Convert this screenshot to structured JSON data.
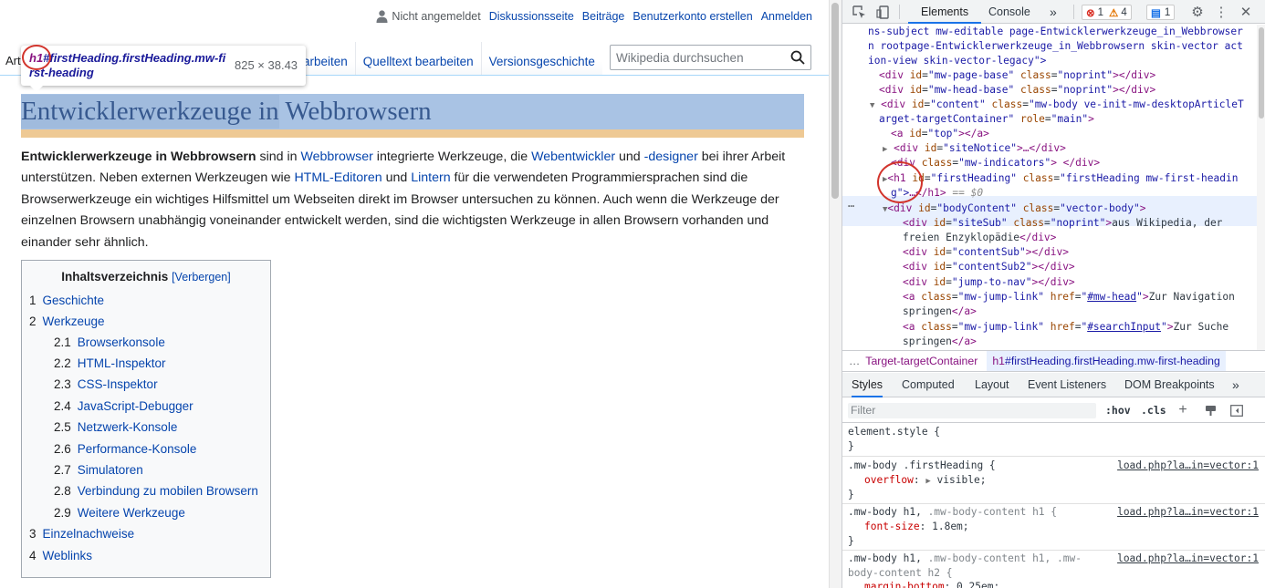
{
  "personal": {
    "anon": "Nicht angemeldet",
    "links": [
      "Diskussionsseite",
      "Beiträge",
      "Benutzerkonto erstellen",
      "Anmelden"
    ]
  },
  "tabs": {
    "left_partial": "Art",
    "right": [
      "Bearbeiten",
      "Quelltext bearbeiten",
      "Versionsgeschichte"
    ],
    "edit_partial": "arbeiten"
  },
  "search": {
    "placeholder": "Wikipedia durchsuchen"
  },
  "tooltip": {
    "tag": "h1",
    "selector": "#firstHeading.firstHeading.mw-first-heading",
    "size": "825 × 38.43"
  },
  "page": {
    "title": "Entwicklerwerkzeuge in Webbrowsern",
    "intro": {
      "bold": "Entwicklerwerkzeuge in Webbrowsern",
      "t1": " sind in ",
      "l1": "Webbrowser",
      "t2": " integrierte Werkzeuge, die ",
      "l2": "Webentwickler",
      "t3": " und ",
      "l3": "-designer",
      "t4": " bei ihrer Arbeit unterstützen. Neben externen Werkzeugen wie ",
      "l4": "HTML-Editoren",
      "t5": " und ",
      "l5": "Lintern",
      "t6": " für die verwendeten Programmiersprachen sind die Browserwerkzeuge ein wichtiges Hilfsmittel um Webseiten direkt im Browser untersuchen zu können. Auch wenn die Werkzeuge der einzelnen Browsern unabhängig voneinander entwickelt werden, sind die wichtigsten Werkzeuge in allen Browsern vorhanden und einander sehr ähnlich."
    }
  },
  "toc": {
    "title": "Inhaltsverzeichnis",
    "toggle": "[Verbergen]",
    "items": [
      {
        "num": "1",
        "label": "Geschichte"
      },
      {
        "num": "2",
        "label": "Werkzeuge"
      },
      {
        "num": "2.1",
        "label": "Browserkonsole"
      },
      {
        "num": "2.2",
        "label": "HTML-Inspektor"
      },
      {
        "num": "2.3",
        "label": "CSS-Inspektor"
      },
      {
        "num": "2.4",
        "label": "JavaScript-Debugger"
      },
      {
        "num": "2.5",
        "label": "Netzwerk-Konsole"
      },
      {
        "num": "2.6",
        "label": "Performance-Konsole"
      },
      {
        "num": "2.7",
        "label": "Simulatoren"
      },
      {
        "num": "2.8",
        "label": "Verbindung zu mobilen Browsern"
      },
      {
        "num": "2.9",
        "label": "Weitere Werkzeuge"
      },
      {
        "num": "3",
        "label": "Einzelnachweise"
      },
      {
        "num": "4",
        "label": "Weblinks"
      }
    ]
  },
  "devtools": {
    "tabs": [
      "Elements",
      "Console"
    ],
    "more": "»",
    "errors": "1",
    "warnings": "4",
    "messages": "1",
    "dom": {
      "l0": "ns-subject mw-editable page-Entwicklerwerkzeuge_in_Webbrowser",
      "l1": "n rootpage-Entwicklerwerkzeuge_in_Webbrowsern skin-vector act",
      "l2": "ion-view skin-vector-legacy\">",
      "page_base_id": "mw-page-base",
      "head_base_id": "mw-head-base",
      "noprint": "noprint",
      "content_id": "content",
      "content_class": "mw-body ve-init-mw-desktopArticleT",
      "content_class_cont": "arget-targetContainer",
      "content_role": "main",
      "top_id": "top",
      "sitenotice_id": "siteNotice",
      "indicators_class": "mw-indicators",
      "h1_id": "firstHeading",
      "h1_class": "firstHeading mw-first-headin",
      "h1_cont": "g\">",
      "h1_end": "…</h1>",
      "eq": "== $0",
      "bodycontent_id": "bodyContent",
      "bodycontent_class": "vector-body",
      "sitesub_id": "siteSub",
      "sitesub_text": "aus Wikipedia, der",
      "sitesub_text2": "freien Enzyklopädie",
      "contentsub": "contentSub",
      "contentsub2": "contentSub2",
      "jump": "jump-to-nav",
      "jump_class": "mw-jump-link",
      "href1": "#mw-head",
      "jump1_text": "Zur Navigation",
      "jump1_text2": "springen",
      "href2": "#searchInput",
      "jump2_text": "Zur Suche",
      "jump2_text2": "springen"
    },
    "breadcrumbs": {
      "dots": "…",
      "c1": "Target-targetContainer",
      "c2_tag": "h1",
      "c2_sel": "#firstHeading.firstHeading.mw-first-heading"
    },
    "subtabs": [
      "Styles",
      "Computed",
      "Layout",
      "Event Listeners",
      "DOM Breakpoints"
    ],
    "filter_placeholder": "Filter",
    "hov": ":hov",
    "cls": ".cls",
    "styles": {
      "element_style": "element.style {",
      "close": "}",
      "r1_sel": ".mw-body .firstHeading {",
      "r1_src": "load.php?la…in=vector:1",
      "r1_prop": "overflow",
      "r1_val": "visible;",
      "r2_sel": ".mw-body h1,",
      "r2_sel_dim": " .mw-body-content h1 {",
      "r2_src": "load.php?la…in=vector:1",
      "r2_prop": "font-size",
      "r2_val": "1.8em;",
      "r3_sel": ".mw-body h1,",
      "r3_sel_dim": " .mw-body-content h1, .mw-",
      "r3_sel_dim2": "body-content h2 {",
      "r3_src": "load.php?la…in=vector:1",
      "r3_prop": "margin-bottom",
      "r3_val": "0.25em;"
    }
  }
}
